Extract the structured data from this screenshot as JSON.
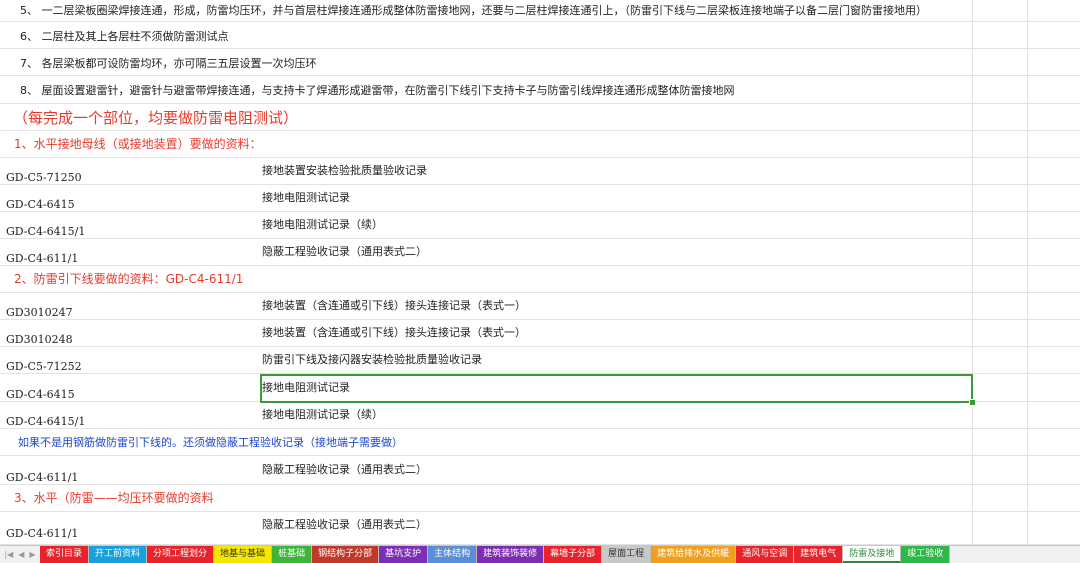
{
  "notes": {
    "n5": "5、 一二层梁板圈梁焊接连通，形成，防雷均压环，并与首层柱焊接连通形成整体防雷接地网，还要与二层柱焊接连通引上，（防雷引下线与二层梁板连接地端子以备二层门窗防雷接地用）",
    "n6": "6、 二层柱及其上各层柱不须做防雷测试点",
    "n7": "7、 各层梁板都可设防雷均环，亦可隔三五层设置一次均压环",
    "n8": "8、 屋面设置避雷针，避雷针与避雷带焊接连通，与支持卡了焊通形成避雷带，在防雷引下线引下支持卡子与防雷引线焊接连通形成整体防雷接地网"
  },
  "headline": "（每完成一个部位，均要做防雷电阻测试）",
  "section1": {
    "title": "1、水平接地母线（或接地装置）要做的资料：",
    "rows": [
      {
        "code": "GD-C5-71250",
        "desc": "接地装置安装检验批质量验收记录"
      },
      {
        "code": "GD-C4-6415",
        "desc": "接地电阻测试记录"
      },
      {
        "code": "GD-C4-6415/1",
        "desc": "接地电阻测试记录（续）"
      },
      {
        "code": "GD-C4-611/1",
        "desc": "隐蔽工程验收记录（通用表式二）"
      }
    ]
  },
  "section2": {
    "title": "2、防雷引下线要做的资料：GD-C4-611/1",
    "rows": [
      {
        "code": "GD3010247",
        "desc": "接地装置（含连通或引下线）接头连接记录（表式一）"
      },
      {
        "code": "GD3010248",
        "desc": "接地装置（含连通或引下线）接头连接记录（表式一）"
      },
      {
        "code": "GD-C5-71252",
        "desc": "防雷引下线及接闪器安装检验批质量验收记录"
      },
      {
        "code": "GD-C4-6415",
        "desc": "接地电阻测试记录"
      },
      {
        "code": "GD-C4-6415/1",
        "desc": "接地电阻测试记录（续）"
      }
    ],
    "blue_note": "如果不是用钢筋做防雷引下线的。还须做隐蔽工程验收记录（接地端子需要做）",
    "extra_row": {
      "code": "GD-C4-611/1",
      "desc": "隐蔽工程验收记录（通用表式二）"
    }
  },
  "section3": {
    "title": "3、水平（防雷——均压环要做的资料",
    "rows": [
      {
        "code": "GD-C4-611/1",
        "desc": "隐蔽工程验收记录（通用表式二）"
      }
    ]
  },
  "colors": {
    "red_text": "#e53b2c",
    "blue_text": "#1f47c9",
    "selection": "#3a9a37",
    "active_tab": "#2e8b3c"
  },
  "tabs": [
    {
      "label": "索引目录",
      "bg": "#e8232b",
      "fg": "#ffffff"
    },
    {
      "label": "开工前资料",
      "bg": "#17a0dc",
      "fg": "#ffffff"
    },
    {
      "label": "分项工程划分",
      "bg": "#e8232b",
      "fg": "#ffffff"
    },
    {
      "label": "地基与基础",
      "bg": "#f5e800",
      "fg": "#333333"
    },
    {
      "label": "桩基础",
      "bg": "#3fb43a",
      "fg": "#ffffff"
    },
    {
      "label": "钢结构子分部",
      "bg": "#c0392b",
      "fg": "#ffffff"
    },
    {
      "label": "基坑支护",
      "bg": "#7b2fb4",
      "fg": "#ffffff"
    },
    {
      "label": "主体结构",
      "bg": "#5b8ed6",
      "fg": "#ffffff"
    },
    {
      "label": "建筑装饰装修",
      "bg": "#7d2db0",
      "fg": "#ffffff"
    },
    {
      "label": "幕墙子分部",
      "bg": "#e8232b",
      "fg": "#ffffff"
    },
    {
      "label": "屋面工程",
      "bg": "#c8c8c8",
      "fg": "#333333"
    },
    {
      "label": "建筑给排水及供暖",
      "bg": "#f0a020",
      "fg": "#ffffff"
    },
    {
      "label": "通风与空调",
      "bg": "#e8232b",
      "fg": "#ffffff"
    },
    {
      "label": "建筑电气",
      "bg": "#e8232b",
      "fg": "#ffffff"
    },
    {
      "label": "防雷及接地",
      "bg": "#ffffff",
      "fg": "#2e8b3c",
      "active": true
    },
    {
      "label": "竣工验收",
      "bg": "#2eb84a",
      "fg": "#ffffff"
    }
  ]
}
